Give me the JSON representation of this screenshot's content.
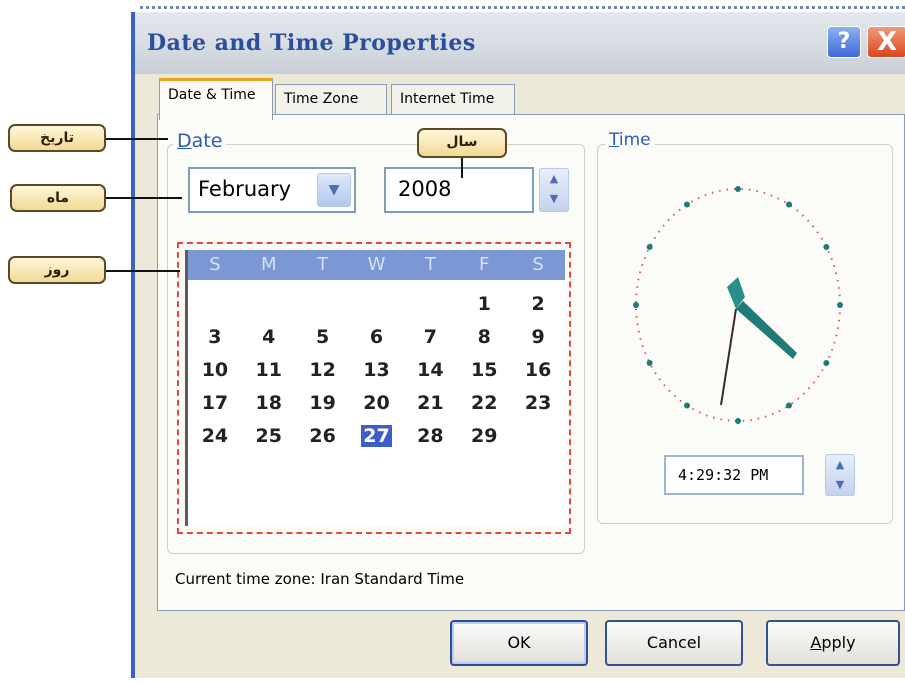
{
  "window": {
    "title": "Date and Time Properties",
    "help_button": "?",
    "close_button": "X"
  },
  "tabs": [
    {
      "label": "Date & Time",
      "active": true
    },
    {
      "label": "Time Zone",
      "active": false
    },
    {
      "label": "Internet Time",
      "active": false
    }
  ],
  "date_group": {
    "label_first": "D",
    "label_rest": "ate",
    "month": "February",
    "year": "2008"
  },
  "calendar": {
    "weekdays": [
      "S",
      "M",
      "T",
      "W",
      "T",
      "F",
      "S"
    ],
    "days": [
      "",
      "",
      "",
      "",
      "",
      "1",
      "2",
      "3",
      "4",
      "5",
      "6",
      "7",
      "8",
      "9",
      "10",
      "11",
      "12",
      "13",
      "14",
      "15",
      "16",
      "17",
      "18",
      "19",
      "20",
      "21",
      "22",
      "23",
      "24",
      "25",
      "26",
      "27",
      "28",
      "29",
      ""
    ],
    "selected_day": "27",
    "header_color": "#7b97d4",
    "highlight_color": "#e04a3a"
  },
  "time_group": {
    "label_first": "T",
    "label_rest": "ime",
    "time": "4:29:32 PM"
  },
  "current_time_zone": "Current time zone:  Iran Standard Time",
  "buttons": {
    "ok": "OK",
    "cancel": "Cancel",
    "apply_first": "A",
    "apply_rest": "pply"
  },
  "callouts": {
    "date": "تاریخ",
    "month": "ماه",
    "day": "روز",
    "year": "سال"
  }
}
